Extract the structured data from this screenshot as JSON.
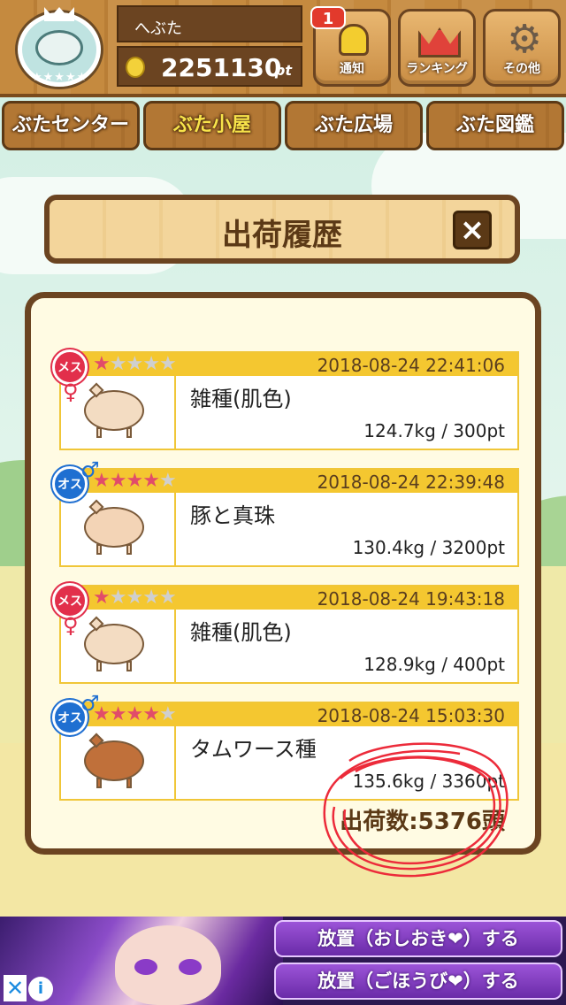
{
  "header": {
    "username": "へぶた",
    "points": "2251130",
    "points_unit": "pt",
    "notification_badge": "1",
    "buttons": {
      "notify": "通知",
      "ranking": "ランキング",
      "other": "その他"
    }
  },
  "nav": {
    "tabs": [
      "ぶたセンター",
      "ぶた小屋",
      "ぶた広場",
      "ぶた図鑑"
    ],
    "active": "ぶた小屋"
  },
  "dialog": {
    "title": "出荷履歴",
    "close": "×"
  },
  "history": [
    {
      "gender": "メス",
      "gender_symbol": "♀",
      "stars": 1,
      "max_stars": 5,
      "date": "2018-08-24 22:41:06",
      "breed": "雑種(肌色)",
      "weight_pt": "124.7kg / 300pt",
      "pig_color": "#f3dcc2"
    },
    {
      "gender": "オス",
      "gender_symbol": "♂",
      "stars": 4,
      "max_stars": 5,
      "date": "2018-08-24 22:39:48",
      "breed": "豚と真珠",
      "weight_pt": "130.4kg / 3200pt",
      "pig_color": "#f3d4b6"
    },
    {
      "gender": "メス",
      "gender_symbol": "♀",
      "stars": 1,
      "max_stars": 5,
      "date": "2018-08-24 19:43:18",
      "breed": "雑種(肌色)",
      "weight_pt": "128.9kg / 400pt",
      "pig_color": "#f3dcc2"
    },
    {
      "gender": "オス",
      "gender_symbol": "♂",
      "stars": 4,
      "max_stars": 5,
      "date": "2018-08-24 15:03:30",
      "breed": "タムワース種",
      "weight_pt": "135.6kg / 3360pt",
      "pig_color": "#c0703a"
    }
  ],
  "total_shipped": "出荷数:5376頭",
  "ad": {
    "button1": "放置（おしおき❤）する",
    "button2": "放置（ごほうび❤）する",
    "close": "✕",
    "info": "i"
  },
  "colors": {
    "brown": "#6b4421",
    "gold": "#f4c730",
    "female": "#e22f4b",
    "male": "#1f6fd1"
  }
}
